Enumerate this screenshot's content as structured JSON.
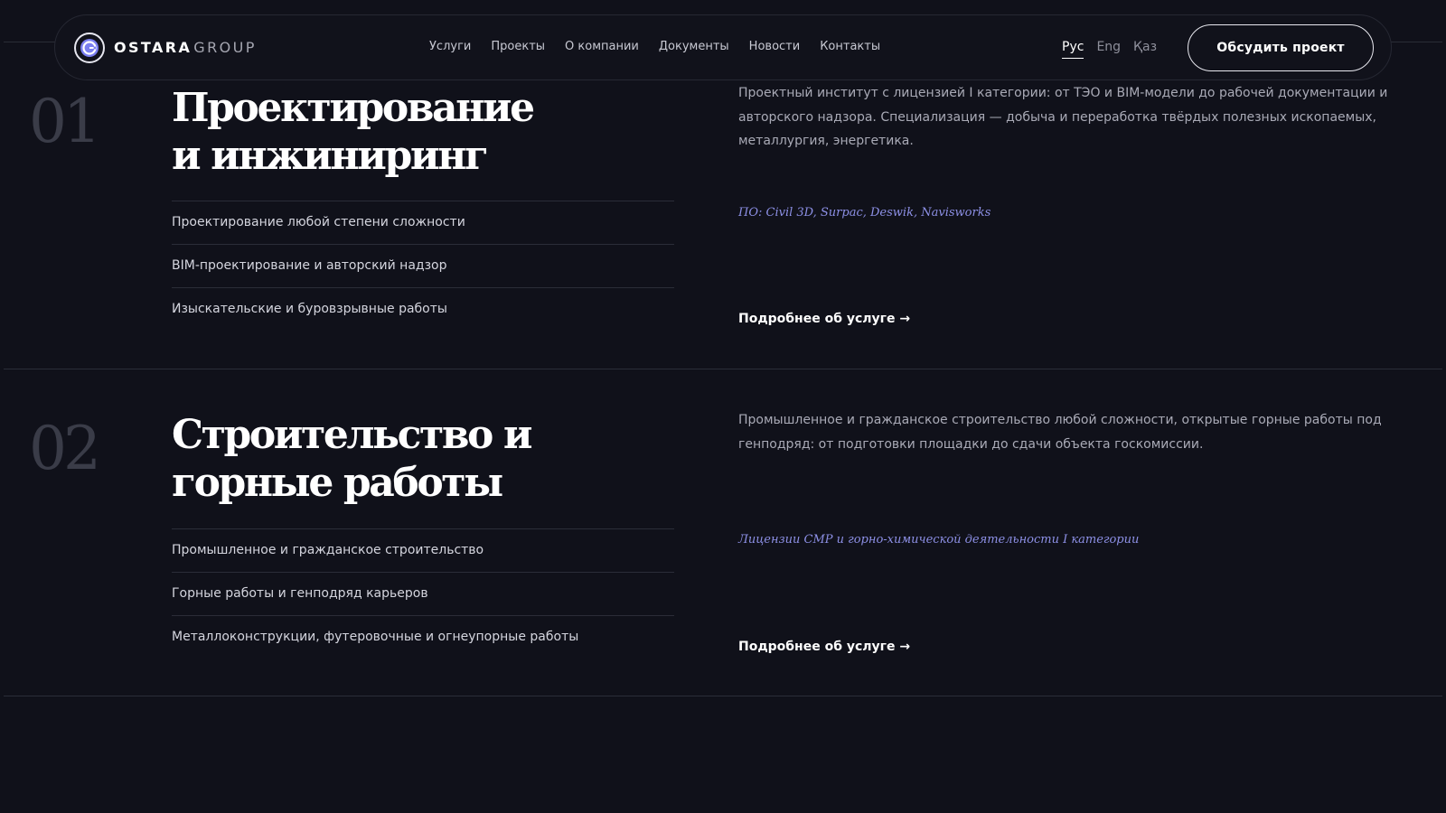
{
  "header": {
    "logo_strong": "OSTARA",
    "logo_light": "GROUP",
    "nav": [
      "Услуги",
      "Проекты",
      "О компании",
      "Документы",
      "Новости",
      "Контакты"
    ],
    "languages": [
      {
        "label": "Рус",
        "active": true
      },
      {
        "label": "Eng",
        "active": false
      },
      {
        "label": "Қаз",
        "active": false
      }
    ],
    "cta_label": "Обсудить проект"
  },
  "services": [
    {
      "number": "01",
      "title_line1": "Проектирование",
      "title_line2": "и инжиниринг",
      "features": [
        "Проектирование любой степени сложности",
        "BIM-проектирование и авторский надзор",
        "Изыскательские и буровзрывные работы"
      ],
      "description": "Проектный институт с лицензией I категории: от ТЭО и BIM-модели до рабочей документации и авторского надзора. Специализация — добыча и переработка твёрдых полезных ископаемых, металлургия, энергетика.",
      "note": "ПО: Civil 3D, Surpac, Deswik, Navisworks",
      "link": "Подробнее об услуге →"
    },
    {
      "number": "02",
      "title_line1": "Строительство и",
      "title_line2": "горные работы",
      "features": [
        "Промышленное и гражданское строительство",
        "Горные работы и генподряд карьеров",
        "Металлоконструкции, футеровочные и огнеупорные работы"
      ],
      "description": "Промышленное и гражданское строительство любой сложности, открытые горные работы под генподряд: от подготовки площадки до сдачи объекта госкомиссии.",
      "note": "Лицензии СМР и горно-химической деятельности I категории",
      "link": "Подробнее об услуге →"
    }
  ],
  "colors": {
    "background": "#10111a",
    "accent_note": "#8d90e6",
    "logo_ring": "#7b7ff0"
  },
  "icons": {
    "logo": "ostara-logo-icon"
  }
}
